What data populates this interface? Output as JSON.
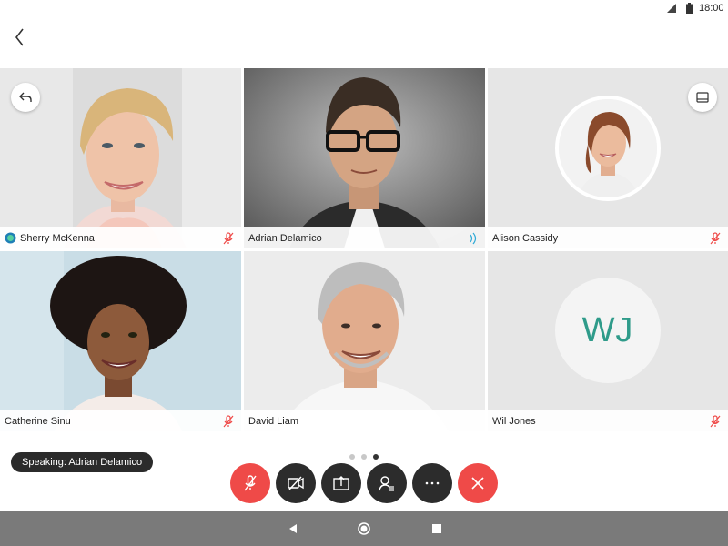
{
  "status_bar": {
    "time": "18:00"
  },
  "participants": [
    {
      "name": "Sherry McKenna",
      "status": "muted",
      "presenter_icon": true
    },
    {
      "name": "Adrian Delamico",
      "status": "speaking",
      "active": true
    },
    {
      "name": "Alison Cassidy",
      "status": "muted"
    },
    {
      "name": "Catherine Sinu",
      "status": "muted"
    },
    {
      "name": "David Liam",
      "status": ""
    },
    {
      "name": "Wil Jones",
      "status": "muted",
      "initials": "WJ"
    }
  ],
  "speaking_banner": "Speaking: Adrian Delamico",
  "pager": {
    "pages": 3,
    "current": 3
  },
  "controls": [
    {
      "name": "mute-button",
      "icon": "mic-off-icon",
      "color": "#ef4a48"
    },
    {
      "name": "video-button",
      "icon": "video-off-icon",
      "color": "#2c2c2c"
    },
    {
      "name": "share-button",
      "icon": "share-icon",
      "color": "#2c2c2c"
    },
    {
      "name": "participants-button",
      "icon": "participants-icon",
      "color": "#2c2c2c"
    },
    {
      "name": "more-button",
      "icon": "more-icon",
      "color": "#2c2c2c"
    },
    {
      "name": "end-call-button",
      "icon": "close-icon",
      "color": "#ef4a48"
    }
  ],
  "colors": {
    "accent": "#2ea9d6",
    "danger": "#ef4a48",
    "initials": "#2f9b8a"
  }
}
